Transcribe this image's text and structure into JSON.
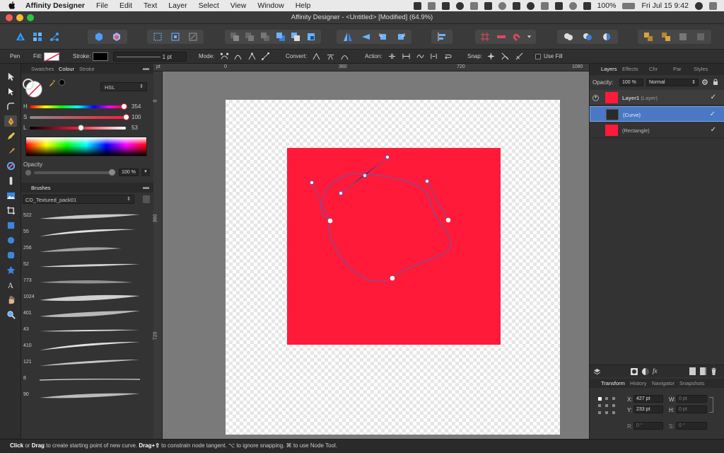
{
  "menubar": {
    "app_name": "Affinity Designer",
    "items": [
      "File",
      "Edit",
      "Text",
      "Layer",
      "Select",
      "View",
      "Window",
      "Help"
    ],
    "battery": "100%",
    "clock": "Fri Jul 15  9:42"
  },
  "window": {
    "title": "Affinity Designer - <Untitled> [Modified] (64.9%)"
  },
  "context_toolbar": {
    "tool_name": "Pen",
    "fill_label": "Fill:",
    "stroke_label": "Stroke:",
    "stroke_width": "1 pt",
    "mode_label": "Mode:",
    "convert_label": "Convert:",
    "action_label": "Action:",
    "snap_label": "Snap:",
    "use_fill_label": "Use Fill"
  },
  "left_panel": {
    "tabs": [
      "Swatches",
      "Colour",
      "Stroke"
    ],
    "active_tab": "Colour",
    "color_model": "HSL",
    "sliders": [
      {
        "label": "H",
        "value": "354",
        "pos": 0.983
      },
      {
        "label": "S",
        "value": "100",
        "pos": 1.0
      },
      {
        "label": "L",
        "value": "53",
        "pos": 0.53
      }
    ],
    "opacity_label": "Opacity",
    "opacity_value": "100 %",
    "brushes_tab": "Brushes",
    "brush_category": "CD_Textured_pack01",
    "brush_sizes": [
      "522",
      "55",
      "256",
      "52",
      "773",
      "1024",
      "401",
      "43",
      "410",
      "121",
      "8",
      "90"
    ]
  },
  "rulers": {
    "top": [
      "pt",
      "0",
      "360",
      "720",
      "1080"
    ],
    "left": [
      "0",
      "360",
      "720"
    ]
  },
  "right_panel": {
    "tabs": [
      "Layers",
      "Effects",
      "Chr",
      "Par",
      "Styles"
    ],
    "opacity_label": "Opacity:",
    "opacity_value": "100 %",
    "blend_mode": "Normal",
    "layers": [
      {
        "name": "Layer1",
        "type": "(Layer)",
        "color": "#ff1a3a"
      },
      {
        "name": "",
        "type": "(Curve)",
        "color": "#2a2a2a"
      },
      {
        "name": "",
        "type": "(Rectangle)",
        "color": "#ff1a3a"
      }
    ],
    "bottom_tabs": [
      "Transform",
      "History",
      "Navigator",
      "Snapshots"
    ],
    "transform": {
      "x_label": "X:",
      "x_value": "427 pt",
      "y_label": "Y:",
      "y_value": "233 pt",
      "w_label": "W:",
      "w_value": "0 pt",
      "h_label": "H:",
      "h_value": "0 pt",
      "r_label": "R:",
      "r_value": "0 °",
      "s_label": "S:",
      "s_value": "0 °"
    }
  },
  "colors": {
    "accent": "#ff1a3a",
    "selection": "#4a78c4",
    "curve": "#5c5fb0"
  },
  "status": {
    "click": "Click",
    "or": " or ",
    "drag": "Drag",
    "text1": " to create starting point of new curve. ",
    "drag2": "Drag+⇧",
    "text2": " to constrain node tangent. ⌥ to ignore snapping. ⌘ to use Node Tool."
  }
}
